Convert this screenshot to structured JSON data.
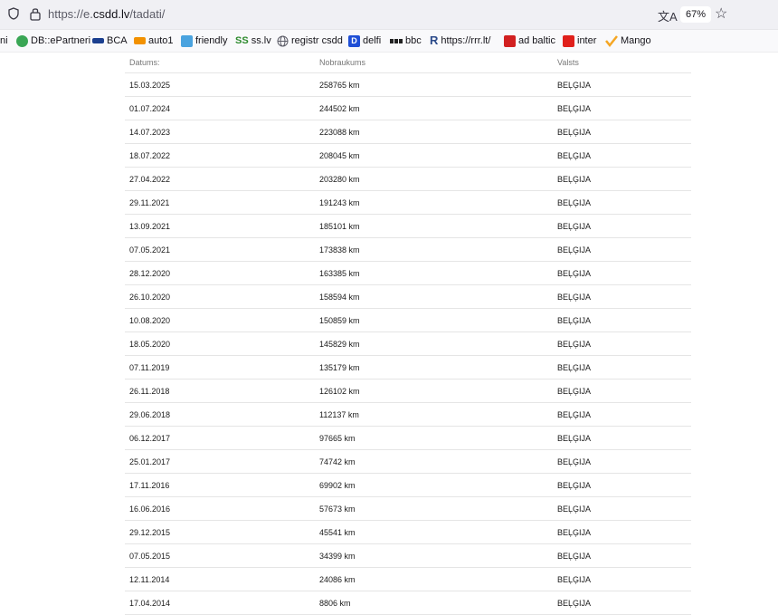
{
  "browser": {
    "url_scheme": "https://e.",
    "url_host": "csdd.lv",
    "url_path": "/tadati/",
    "translate_icon": "translate-icon",
    "zoom": "67%"
  },
  "bookmarks": [
    {
      "label": "ni",
      "icon": "none",
      "color": "#ffffff"
    },
    {
      "label": "DB::ePartneri",
      "icon": "db-icon",
      "color": "#3aa655"
    },
    {
      "label": "BCA",
      "icon": "bca-icon",
      "color": "#1b3f8f"
    },
    {
      "label": "auto1",
      "icon": "auto1-icon",
      "color": "#f29100"
    },
    {
      "label": "friendly",
      "icon": "friendly-icon",
      "color": "#4aa3df"
    },
    {
      "label": "ss.lv",
      "icon": "ss-icon",
      "color": "#2e8b2e"
    },
    {
      "label": "registr csdd",
      "icon": "globe-icon",
      "color": "#5b5b66"
    },
    {
      "label": "delfi",
      "icon": "delfi-icon",
      "color": "#1f4fd6"
    },
    {
      "label": "bbc",
      "icon": "bbc-icon",
      "color": "#222222"
    },
    {
      "label": "https://rrr.lt/",
      "icon": "rrr-icon",
      "color": "#2b4a8a"
    },
    {
      "label": "ad baltic",
      "icon": "adbaltic-icon",
      "color": "#d22020"
    },
    {
      "label": "inter",
      "icon": "inter-icon",
      "color": "#e0201b"
    },
    {
      "label": "Mango",
      "icon": "mango-icon",
      "color": "#f5a623"
    }
  ],
  "table": {
    "headers": [
      "Datums:",
      "Nobraukums",
      "Valsts"
    ],
    "rows": [
      [
        "15.03.2025",
        "258765 km",
        "BEĻĢIJA"
      ],
      [
        "01.07.2024",
        "244502 km",
        "BEĻĢIJA"
      ],
      [
        "14.07.2023",
        "223088 km",
        "BEĻĢIJA"
      ],
      [
        "18.07.2022",
        "208045 km",
        "BEĻĢIJA"
      ],
      [
        "27.04.2022",
        "203280 km",
        "BEĻĢIJA"
      ],
      [
        "29.11.2021",
        "191243 km",
        "BEĻĢIJA"
      ],
      [
        "13.09.2021",
        "185101 km",
        "BEĻĢIJA"
      ],
      [
        "07.05.2021",
        "173838 km",
        "BEĻĢIJA"
      ],
      [
        "28.12.2020",
        "163385 km",
        "BEĻĢIJA"
      ],
      [
        "26.10.2020",
        "158594 km",
        "BEĻĢIJA"
      ],
      [
        "10.08.2020",
        "150859 km",
        "BEĻĢIJA"
      ],
      [
        "18.05.2020",
        "145829 km",
        "BEĻĢIJA"
      ],
      [
        "07.11.2019",
        "135179 km",
        "BEĻĢIJA"
      ],
      [
        "26.11.2018",
        "126102 km",
        "BEĻĢIJA"
      ],
      [
        "29.06.2018",
        "112137 km",
        "BEĻĢIJA"
      ],
      [
        "06.12.2017",
        "97665 km",
        "BEĻĢIJA"
      ],
      [
        "25.01.2017",
        "74742 km",
        "BEĻĢIJA"
      ],
      [
        "17.11.2016",
        "69902 km",
        "BEĻĢIJA"
      ],
      [
        "16.06.2016",
        "57673 km",
        "BEĻĢIJA"
      ],
      [
        "29.12.2015",
        "45541 km",
        "BEĻĢIJA"
      ],
      [
        "07.05.2015",
        "34399 km",
        "BEĻĢIJA"
      ],
      [
        "12.11.2014",
        "24086 km",
        "BEĻĢIJA"
      ],
      [
        "17.04.2014",
        "8806 km",
        "BEĻĢIJA"
      ]
    ]
  }
}
